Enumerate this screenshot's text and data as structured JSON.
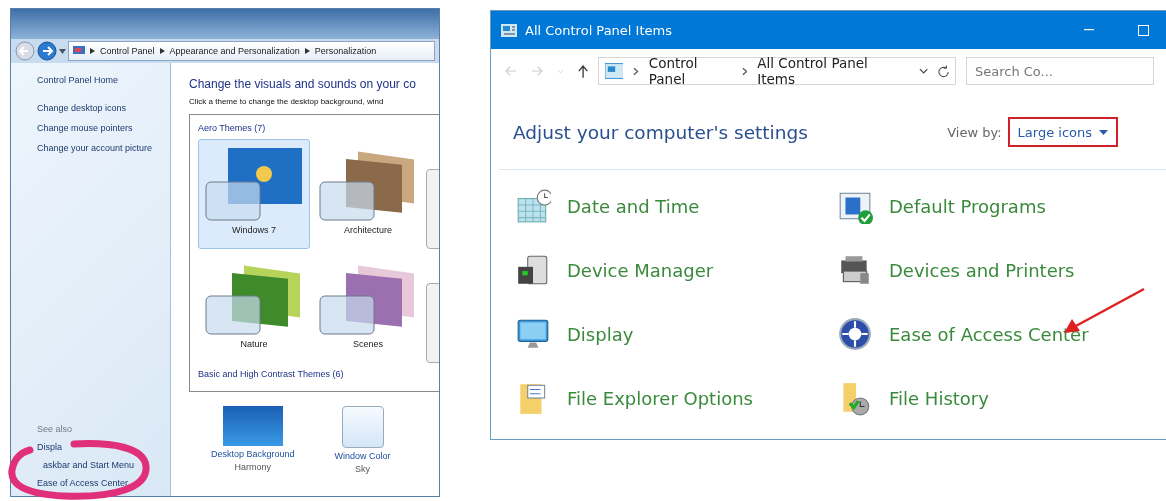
{
  "left_window": {
    "breadcrumb": [
      "Control Panel",
      "Appearance and Personalization",
      "Personalization"
    ],
    "sidebar": {
      "links": [
        "Control Panel Home",
        "Change desktop icons",
        "Change mouse pointers",
        "Change your account picture"
      ],
      "see_also_heading": "See also",
      "see_also": [
        "Displa",
        "askbar and Start Menu",
        "Ease of Access Center"
      ]
    },
    "heading": "Change the visuals and sounds on your co",
    "instructions": "Click a theme to change the desktop background, wind",
    "themes_box": {
      "aero_title": "Aero Themes (7)",
      "themes": [
        {
          "name": "Windows 7",
          "selected": true
        },
        {
          "name": "Architecture",
          "selected": false
        },
        {
          "name": "Nature",
          "selected": false
        },
        {
          "name": "Scenes",
          "selected": false
        }
      ],
      "basic_title": "Basic and High Contrast Themes (6)"
    },
    "settings": [
      {
        "label": "Desktop Background",
        "value": "Harmony"
      },
      {
        "label": "Window Color",
        "value": "Sky"
      }
    ]
  },
  "right_window": {
    "title": "All Control Panel Items",
    "breadcrumb": [
      "Control Panel",
      "All Control Panel Items"
    ],
    "search": {
      "placeholder": "Search Co..."
    },
    "heading": "Adjust your computer's settings",
    "view_by": {
      "label": "View by:",
      "value": "Large icons"
    },
    "items": [
      "Date and Time",
      "Default Programs",
      "Device Manager",
      "Devices and Printers",
      "Display",
      "Ease of Access Center",
      "File Explorer Options",
      "File History"
    ]
  }
}
